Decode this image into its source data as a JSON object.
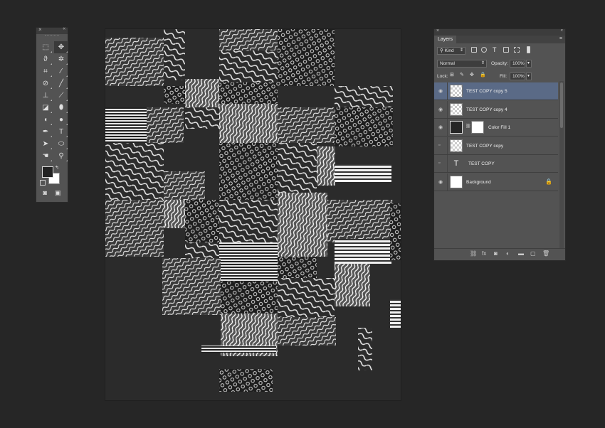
{
  "tools_panel": {
    "close": "×",
    "collapse": "«",
    "tools": [
      {
        "name": "rectangular-marquee-icon",
        "glyph": "⬚"
      },
      {
        "name": "move-icon",
        "glyph": "✥",
        "active": true
      },
      {
        "name": "lasso-icon",
        "glyph": "ϑ"
      },
      {
        "name": "magic-wand-icon",
        "glyph": "✲"
      },
      {
        "name": "crop-icon",
        "glyph": "⌗"
      },
      {
        "name": "eyedropper-icon",
        "glyph": "⁄"
      },
      {
        "name": "spot-healing-icon",
        "glyph": "⊘"
      },
      {
        "name": "brush-icon",
        "glyph": "╱"
      },
      {
        "name": "clone-stamp-icon",
        "glyph": "⊥"
      },
      {
        "name": "history-brush-icon",
        "glyph": "⟋"
      },
      {
        "name": "eraser-icon",
        "glyph": "◪"
      },
      {
        "name": "paint-bucket-icon",
        "glyph": "⬮"
      },
      {
        "name": "blur-icon",
        "glyph": "◖"
      },
      {
        "name": "dodge-icon",
        "glyph": "●"
      },
      {
        "name": "pen-icon",
        "glyph": "✒"
      },
      {
        "name": "type-icon",
        "glyph": "T"
      },
      {
        "name": "path-selection-icon",
        "glyph": "➤"
      },
      {
        "name": "ellipse-icon",
        "glyph": "⬭"
      },
      {
        "name": "hand-icon",
        "glyph": "☚"
      },
      {
        "name": "zoom-icon",
        "glyph": "⚲"
      }
    ],
    "bottom": [
      {
        "name": "quick-mask-icon",
        "glyph": "◙"
      },
      {
        "name": "screen-mode-icon",
        "glyph": "▣"
      }
    ]
  },
  "layers_panel": {
    "close": "×",
    "collapse": "«",
    "tab_label": "Layers",
    "menu_icon": "≡",
    "filter_label": "Kind",
    "blend_mode": "Normal",
    "opacity_label": "Opacity:",
    "opacity_value": "100%",
    "lock_label": "Lock:",
    "fill_label": "Fill:",
    "fill_value": "100%",
    "layers": [
      {
        "name": "TEST COPY copy 5",
        "visible": true,
        "thumb": "checker",
        "active": true
      },
      {
        "name": "TEST COPY copy 4",
        "visible": true,
        "thumb": "checker"
      },
      {
        "name": "Color Fill 1",
        "visible": true,
        "thumb": "fill"
      },
      {
        "name": "TEST COPY copy",
        "visible": false,
        "thumb": "checker"
      },
      {
        "name": "TEST COPY",
        "visible": false,
        "thumb": "type"
      },
      {
        "name": "Background",
        "visible": true,
        "thumb": "white",
        "locked": true
      }
    ],
    "footer_icons": [
      "link-icon",
      "fx-icon",
      "mask-icon",
      "adjustment-icon",
      "group-folder-icon",
      "new-layer-icon",
      "trash-icon"
    ]
  },
  "canvas": {
    "background_color": "#2b2b2b"
  }
}
